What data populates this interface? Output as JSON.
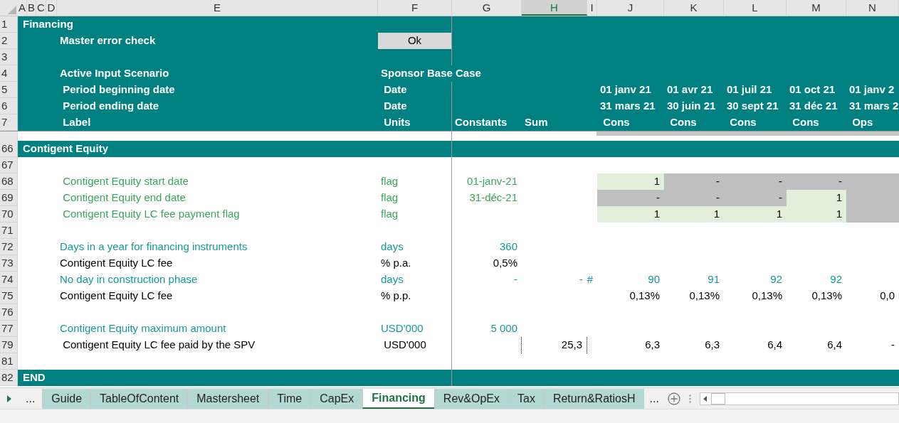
{
  "columns": [
    {
      "letter": "A",
      "selected": false
    },
    {
      "letter": "B",
      "selected": false
    },
    {
      "letter": "C",
      "selected": false
    },
    {
      "letter": "D",
      "selected": false
    },
    {
      "letter": "E",
      "selected": false
    },
    {
      "letter": "F",
      "selected": false
    },
    {
      "letter": "G",
      "selected": false
    },
    {
      "letter": "H",
      "selected": true
    },
    {
      "letter": "I",
      "selected": false
    },
    {
      "letter": "J",
      "selected": false
    },
    {
      "letter": "K",
      "selected": false
    },
    {
      "letter": "L",
      "selected": false
    },
    {
      "letter": "M",
      "selected": false
    },
    {
      "letter": "N",
      "selected": false
    }
  ],
  "rows": [
    {
      "number": "1",
      "kind": "title",
      "label": "Financing"
    },
    {
      "number": "2",
      "kind": "check",
      "label": "Master error check",
      "status": "Ok"
    },
    {
      "number": "3",
      "kind": "band"
    },
    {
      "number": "4",
      "kind": "scenario",
      "label": "Active Input Scenario",
      "value": "Sponsor Base Case"
    },
    {
      "number": "5",
      "kind": "heading",
      "label": " Period beginning date",
      "unit": " Date",
      "periods": [
        "01 janv 21",
        "01 avr 21",
        "01 juil 21",
        "01 oct 21",
        "01 janv 2"
      ]
    },
    {
      "number": "6",
      "kind": "heading",
      "label": " Period ending date",
      "unit": " Date",
      "periods": [
        "31 mars 21",
        "30 juin 21",
        "30 sept 21",
        "31 déc 21",
        "31 mars 2"
      ]
    },
    {
      "number": "7",
      "kind": "heading",
      "label": " Label",
      "unit": " Units",
      "constant": "Constants",
      "sum": "Sum",
      "periods": [
        " Cons",
        " Cons",
        " Cons",
        " Cons",
        " Ops"
      ]
    },
    {
      "number": "66",
      "kind": "section",
      "label": "Contigent Equity"
    },
    {
      "number": "67",
      "kind": "blank"
    },
    {
      "number": "68",
      "kind": "flag",
      "label": " Contigent Equity start date",
      "unit": "flag",
      "constant": "01-janv-21",
      "periods": [
        {
          "text": "1",
          "on": true
        },
        {
          "text": "-",
          "on": false
        },
        {
          "text": "-",
          "on": false
        },
        {
          "text": "-",
          "on": false
        },
        {
          "on": false
        }
      ]
    },
    {
      "number": "69",
      "kind": "flag",
      "label": " Contigent Equity end date",
      "unit": "flag",
      "constant": "31-déc-21",
      "periods": [
        {
          "text": "-",
          "on": false
        },
        {
          "text": "-",
          "on": false
        },
        {
          "text": "-",
          "on": false
        },
        {
          "text": "1",
          "on": true
        },
        {
          "on": false
        }
      ]
    },
    {
      "number": "70",
      "kind": "flag",
      "label": " Contigent Equity LC fee payment flag",
      "unit": "flag",
      "periods": [
        {
          "text": "1",
          "on": true
        },
        {
          "text": "1",
          "on": true
        },
        {
          "text": "1",
          "on": true
        },
        {
          "text": "1",
          "on": true
        },
        {
          "on": false
        }
      ]
    },
    {
      "number": "71",
      "kind": "blank"
    },
    {
      "number": "72",
      "kind": "input",
      "label": "Days in a year for financing instruments",
      "unit": "days",
      "constant": "360"
    },
    {
      "number": "73",
      "kind": "calc",
      "label": "Contigent Equity LC fee",
      "unit": "% p.a.",
      "constant": "0,5%"
    },
    {
      "number": "74",
      "kind": "input",
      "label": "No day in construction phase",
      "unit": "days",
      "constant": "-",
      "sum": "-",
      "marker": "#",
      "periods": [
        "90",
        "91",
        "92",
        "92"
      ]
    },
    {
      "number": "75",
      "kind": "calc",
      "label": "Contigent Equity LC fee",
      "unit": "% p.p.",
      "periods": [
        "0,13%",
        "0,13%",
        "0,13%",
        "0,13%",
        "0,0"
      ]
    },
    {
      "number": "76",
      "kind": "blank"
    },
    {
      "number": "77",
      "kind": "input",
      "label": "Contigent Equity maximum amount",
      "unit": "USD'000",
      "constant": "5 000"
    },
    {
      "number": "79",
      "kind": "total",
      "label": " Contigent Equity LC fee paid by the SPV",
      "unit": " USD'000",
      "sum": "25,3",
      "periods": [
        "6,3",
        "6,3",
        "6,4",
        "6,4",
        "-"
      ]
    },
    {
      "number": "81",
      "kind": "blank"
    },
    {
      "number": "82",
      "kind": "section",
      "label": "END"
    }
  ],
  "tabs": {
    "left_more": "...",
    "items": [
      {
        "label": "Guide",
        "selected": false
      },
      {
        "label": "TableOfContent",
        "selected": false
      },
      {
        "label": "Mastersheet",
        "selected": false
      },
      {
        "label": "Time",
        "selected": false
      },
      {
        "label": "CapEx",
        "selected": false
      },
      {
        "label": "Financing",
        "selected": true
      },
      {
        "label": "Rev&OpEx",
        "selected": false
      },
      {
        "label": "Tax",
        "selected": false
      },
      {
        "label": "Return&RatiosH",
        "selected": false
      }
    ],
    "right_more": "..."
  }
}
